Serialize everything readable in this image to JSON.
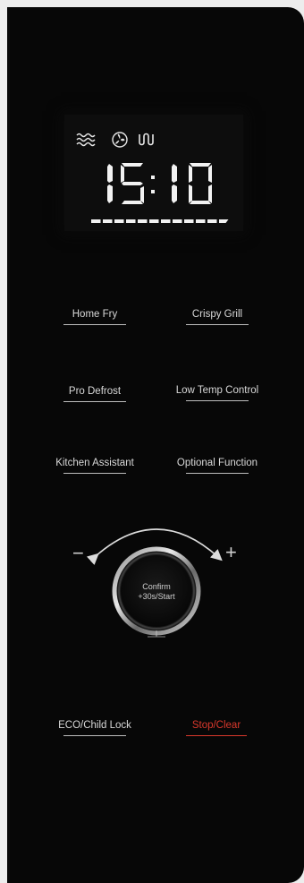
{
  "display": {
    "time": "15:10",
    "icons": [
      "steam-waves-icon",
      "fan-icon",
      "grill-heater-icon"
    ],
    "progress_segments": 12
  },
  "buttons": {
    "home_fry": "Home Fry",
    "crispy_grill": "Crispy Grill",
    "pro_defrost": "Pro Defrost",
    "low_temp_control": "Low Temp Control",
    "kitchen_assistant": "Kitchen Assistant",
    "optional_function": "Optional Function",
    "eco_child_lock": "ECO/Child Lock",
    "stop_clear": "Stop/Clear"
  },
  "dial": {
    "minus": "−",
    "plus": "+",
    "confirm": "Confirm",
    "start": "+30s/Start"
  },
  "colors": {
    "panel": "#070707",
    "text": "#d8d8d8",
    "stop_accent": "#d9382c"
  }
}
